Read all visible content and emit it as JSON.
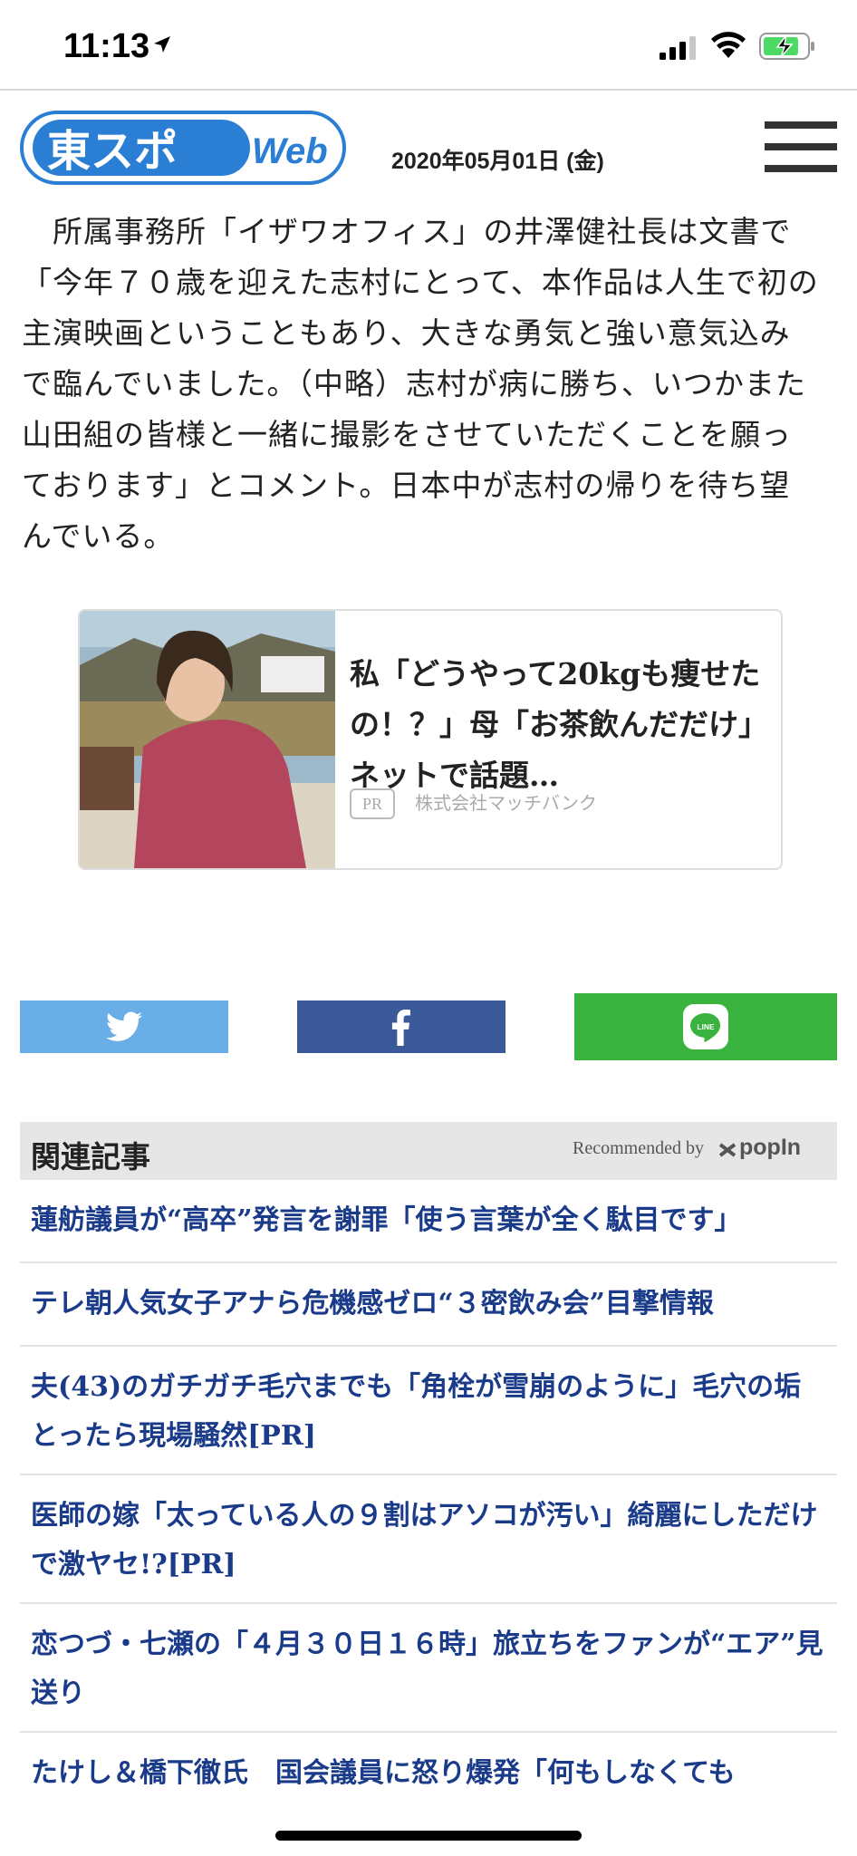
{
  "status_bar": {
    "time": "11:13",
    "location_icon": "location-arrow-icon",
    "signal_icon": "cellular-signal-icon",
    "wifi_icon": "wifi-icon",
    "battery_icon": "battery-charging-icon"
  },
  "header": {
    "logo_text_main": "東スポ",
    "logo_text_sub": "Web",
    "date": "2020年05月01日 (金)",
    "menu_icon": "hamburger-menu-icon"
  },
  "article": {
    "body": "　所属事務所「イザワオフィス」の井澤健社長は文書で「今年７０歳を迎えた志村にとって、本作品は人生で初の主演映画ということもあり、大きな勇気と強い意気込みで臨んでいました。（中略）志村が病に勝ち、いつかまた山田組の皆様と一緒に撮影をさせていただくことを願っております」とコメント。日本中が志村の帰りを待ち望んでいる。"
  },
  "ad": {
    "title": "私「どうやって20kgも痩せたの！？」母「お茶飲んだだけ」ネットで話題…",
    "badge": "PR",
    "sponsor": "株式会社マッチバンク"
  },
  "share": {
    "twitter_icon": "twitter-bird-icon",
    "facebook_icon": "facebook-f-icon",
    "line_icon": "line-icon",
    "line_label": "LINE",
    "twitter_color": "#6aaee8",
    "facebook_color": "#3b5998",
    "line_color": "#3ab33e"
  },
  "related": {
    "heading": "関連記事",
    "recommended_by": "Recommended by",
    "provider": "popIn",
    "items": [
      "蓮舫議員が“高卒”発言を謝罪「使う言葉が全く駄目です」",
      "テレ朝人気女子アナら危機感ゼロ“３密飲み会”目撃情報",
      "夫(43)のガチガチ毛穴までも「角栓が雪崩のように」毛穴の垢とったら現場騒然[PR]",
      "医師の嫁「太っている人の９割はアソコが汚い」綺麗にしただけで激ヤセ!?[PR]",
      "恋つづ・七瀬の「４月３０日１６時」旅立ちをファンが“エア”見送り",
      "たけし＆橋下徹氏　国会議員に怒り爆発「何もしなくても"
    ]
  }
}
